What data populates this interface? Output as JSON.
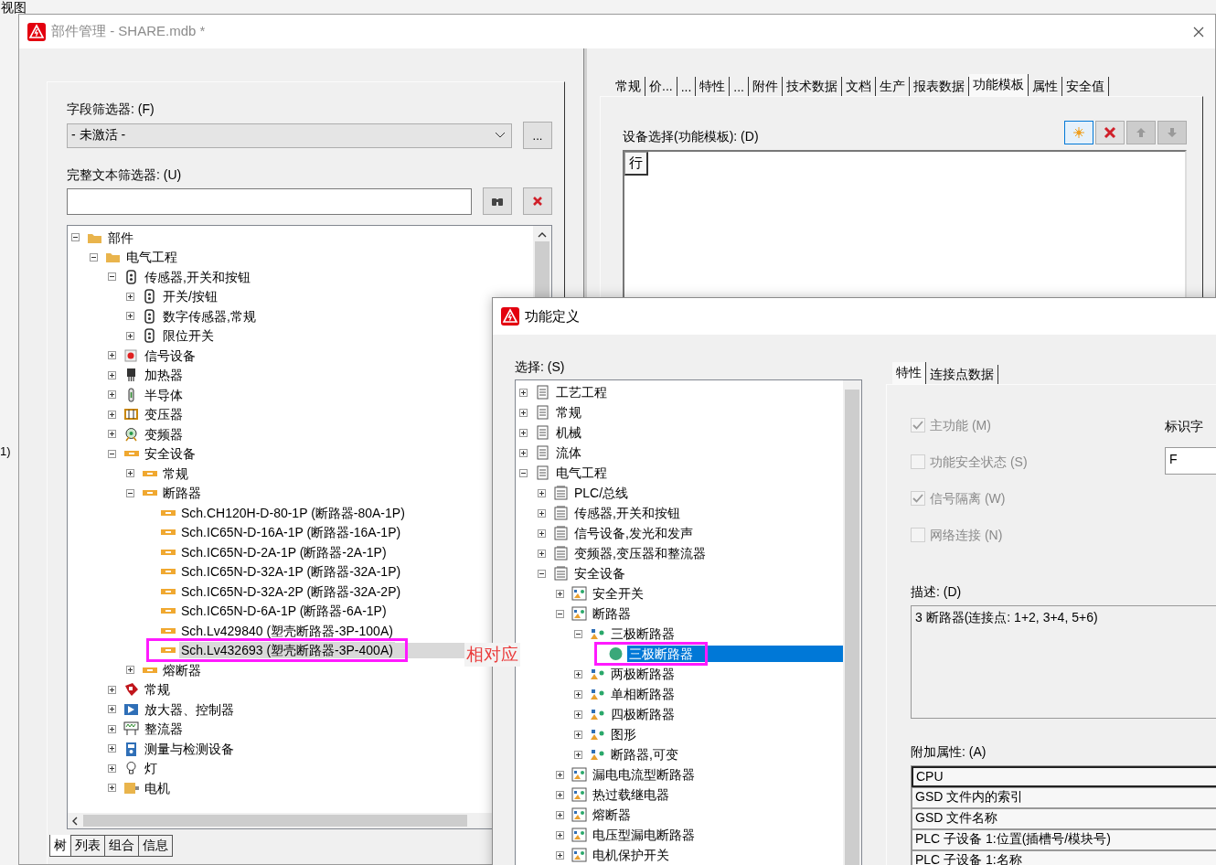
{
  "background_app": {
    "menu_text": "视图",
    "side_text": "1)"
  },
  "main_window": {
    "title": "部件管理 - SHARE.mdb *",
    "left_pane": {
      "field_filter": {
        "label": "字段筛选器: (F)",
        "value": "- 未激活 -",
        "button": "..."
      },
      "text_filter": {
        "label": "完整文本筛选器: (U)"
      },
      "tree": [
        {
          "label": "部件",
          "kind": "folder",
          "expanded": true,
          "selected": false,
          "children": [
            {
              "label": "电气工程",
              "kind": "folder",
              "expanded": true,
              "selected": false,
              "children": [
                {
                  "label": "传感器,开关和按钮",
                  "kind": "sensor",
                  "expanded": true,
                  "selected": false,
                  "children": [
                    {
                      "label": "开关/按钮",
                      "kind": "sensor",
                      "expanded": false,
                      "selected": false
                    },
                    {
                      "label": "数字传感器,常规",
                      "kind": "sensor",
                      "expanded": false,
                      "selected": false
                    },
                    {
                      "label": "限位开关",
                      "kind": "sensor",
                      "expanded": false,
                      "selected": false
                    }
                  ]
                },
                {
                  "label": "信号设备",
                  "kind": "signal",
                  "expanded": false,
                  "selected": false
                },
                {
                  "label": "加热器",
                  "kind": "heater",
                  "expanded": false,
                  "selected": false
                },
                {
                  "label": "半导体",
                  "kind": "semiconductor",
                  "expanded": false,
                  "selected": false
                },
                {
                  "label": "变压器",
                  "kind": "transformer",
                  "expanded": false,
                  "selected": false
                },
                {
                  "label": "变频器",
                  "kind": "vfd",
                  "expanded": false,
                  "selected": false
                },
                {
                  "label": "安全设备",
                  "kind": "breaker",
                  "expanded": true,
                  "selected": false,
                  "children": [
                    {
                      "label": "常规",
                      "kind": "breaker",
                      "expanded": false,
                      "selected": false
                    },
                    {
                      "label": "断路器",
                      "kind": "breaker",
                      "expanded": true,
                      "selected": false,
                      "children": [
                        {
                          "label": "Sch.CH120H-D-80-1P (断路器-80A-1P)",
                          "kind": "breaker",
                          "selected": false
                        },
                        {
                          "label": "Sch.IC65N-D-16A-1P (断路器-16A-1P)",
                          "kind": "breaker",
                          "selected": false
                        },
                        {
                          "label": "Sch.IC65N-D-2A-1P (断路器-2A-1P)",
                          "kind": "breaker",
                          "selected": false
                        },
                        {
                          "label": "Sch.IC65N-D-32A-1P (断路器-32A-1P)",
                          "kind": "breaker",
                          "selected": false
                        },
                        {
                          "label": "Sch.IC65N-D-32A-2P (断路器-32A-2P)",
                          "kind": "breaker",
                          "selected": false
                        },
                        {
                          "label": "Sch.IC65N-D-6A-1P (断路器-6A-1P)",
                          "kind": "breaker",
                          "selected": false
                        },
                        {
                          "label": "Sch.Lv429840 (塑壳断路器-3P-100A)",
                          "kind": "breaker",
                          "selected": false
                        },
                        {
                          "label": "Sch.Lv432693 (塑壳断路器-3P-400A)",
                          "kind": "breaker",
                          "selected": true,
                          "highlighted": true
                        }
                      ]
                    },
                    {
                      "label": "熔断器",
                      "kind": "breaker",
                      "expanded": false,
                      "selected": false
                    }
                  ]
                },
                {
                  "label": "常规",
                  "kind": "general",
                  "expanded": false,
                  "selected": false
                },
                {
                  "label": "放大器、控制器",
                  "kind": "amplifier",
                  "expanded": false,
                  "selected": false
                },
                {
                  "label": "整流器",
                  "kind": "rectifier",
                  "expanded": false,
                  "selected": false
                },
                {
                  "label": "测量与检测设备",
                  "kind": "meter",
                  "expanded": false,
                  "selected": false
                },
                {
                  "label": "灯",
                  "kind": "lamp",
                  "expanded": false,
                  "selected": false
                },
                {
                  "label": "电机",
                  "kind": "motor",
                  "expanded": false,
                  "selected": false
                }
              ]
            }
          ]
        }
      ],
      "bottom_tabs": [
        {
          "label": "树",
          "selected": true
        },
        {
          "label": "列表",
          "selected": false
        },
        {
          "label": "组合",
          "selected": false
        },
        {
          "label": "信息",
          "selected": false
        }
      ]
    },
    "right_pane": {
      "tabs": [
        {
          "label": "常规",
          "selected": false
        },
        {
          "label": "价...",
          "selected": false
        },
        {
          "label": "...",
          "selected": false
        },
        {
          "label": "特性",
          "selected": false
        },
        {
          "label": "...",
          "selected": false
        },
        {
          "label": "附件",
          "selected": false
        },
        {
          "label": "技术数据",
          "selected": false
        },
        {
          "label": "文档",
          "selected": false
        },
        {
          "label": "生产",
          "selected": false
        },
        {
          "label": "报表数据",
          "selected": false
        },
        {
          "label": "功能模板",
          "selected": true
        },
        {
          "label": "属性",
          "selected": false
        },
        {
          "label": "安全值",
          "selected": false
        }
      ],
      "device_label": "设备选择(功能模板): (D)",
      "toolbar": [
        {
          "kind": "new",
          "focused": true,
          "disabled": false
        },
        {
          "kind": "delete",
          "focused": false,
          "disabled": false
        },
        {
          "kind": "up",
          "focused": false,
          "disabled": true
        },
        {
          "kind": "down",
          "focused": false,
          "disabled": true
        }
      ],
      "grid": {
        "columns": [
          "行"
        ]
      }
    }
  },
  "annotation": {
    "label": "相对应"
  },
  "dialog": {
    "title": "功能定义",
    "select_label": "选择: (S)",
    "tree": [
      {
        "label": "工艺工程",
        "kind": "list",
        "expanded": false,
        "selected": false
      },
      {
        "label": "常规",
        "kind": "list",
        "expanded": false,
        "selected": false
      },
      {
        "label": "机械",
        "kind": "list",
        "expanded": false,
        "selected": false
      },
      {
        "label": "流体",
        "kind": "list",
        "expanded": false,
        "selected": false
      },
      {
        "label": "电气工程",
        "kind": "list",
        "expanded": true,
        "selected": false,
        "children": [
          {
            "label": "PLC/总线",
            "kind": "stack",
            "expanded": false,
            "selected": false
          },
          {
            "label": "传感器,开关和按钮",
            "kind": "stack",
            "expanded": false,
            "selected": false
          },
          {
            "label": "信号设备,发光和发声",
            "kind": "stack",
            "expanded": false,
            "selected": false
          },
          {
            "label": "变频器,变压器和整流器",
            "kind": "stack",
            "expanded": false,
            "selected": false
          },
          {
            "label": "安全设备",
            "kind": "stack",
            "expanded": true,
            "selected": false,
            "children": [
              {
                "label": "安全开关",
                "kind": "picture",
                "expanded": false,
                "selected": false
              },
              {
                "label": "断路器",
                "kind": "picture",
                "expanded": true,
                "selected": false,
                "children": [
                  {
                    "label": "三极断路器",
                    "kind": "shapes",
                    "expanded": true,
                    "selected": false,
                    "children": [
                      {
                        "label": "三极断路器",
                        "kind": "circle",
                        "selected": true,
                        "highlighted": true
                      }
                    ]
                  },
                  {
                    "label": "两极断路器",
                    "kind": "shapes",
                    "expanded": false,
                    "selected": false
                  },
                  {
                    "label": "单相断路器",
                    "kind": "shapes",
                    "expanded": false,
                    "selected": false
                  },
                  {
                    "label": "四极断路器",
                    "kind": "shapes",
                    "expanded": false,
                    "selected": false
                  },
                  {
                    "label": "图形",
                    "kind": "shapes",
                    "expanded": false,
                    "selected": false
                  },
                  {
                    "label": "断路器,可变",
                    "kind": "shapes",
                    "expanded": false,
                    "selected": false
                  }
                ]
              },
              {
                "label": "漏电电流型断路器",
                "kind": "picture",
                "expanded": false,
                "selected": false
              },
              {
                "label": "热过载继电器",
                "kind": "picture",
                "expanded": false,
                "selected": false
              },
              {
                "label": "熔断器",
                "kind": "picture",
                "expanded": false,
                "selected": false
              },
              {
                "label": "电压型漏电断路器",
                "kind": "picture",
                "expanded": false,
                "selected": false
              },
              {
                "label": "电机保护开关",
                "kind": "picture",
                "expanded": false,
                "selected": false
              }
            ]
          }
        ]
      }
    ],
    "tabs": [
      {
        "label": "特性",
        "selected": true
      },
      {
        "label": "连接点数据",
        "selected": false
      }
    ],
    "options": [
      {
        "label": "主功能 (M)",
        "checked": true,
        "disabled": true
      },
      {
        "label": "功能安全状态 (S)",
        "checked": false,
        "disabled": true
      },
      {
        "label": "信号隔离 (W)",
        "checked": true,
        "disabled": true
      },
      {
        "label": "网络连接 (N)",
        "checked": false,
        "disabled": true
      }
    ],
    "id_letter": {
      "label": "标识字",
      "value": "F"
    },
    "description": {
      "label": "描述: (D)",
      "value": "3 断路器(连接点: 1+2, 3+4, 5+6)"
    },
    "extra": {
      "label": "附加属性: (A)",
      "rows": [
        {
          "label": "CPU",
          "selected": true
        },
        {
          "label": "GSD 文件内的索引",
          "selected": false
        },
        {
          "label": "GSD 文件名称",
          "selected": false
        },
        {
          "label": "PLC 子设备 1:位置(插槽号/模块号)",
          "selected": false
        },
        {
          "label": "PLC 子设备 1:名称",
          "selected": false
        }
      ]
    }
  }
}
